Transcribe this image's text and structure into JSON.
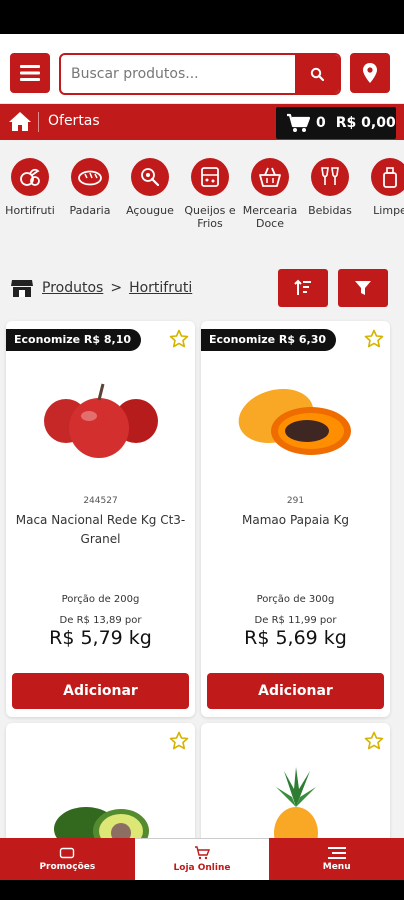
{
  "colors": {
    "primary": "#c01a1a",
    "dark": "#111111"
  },
  "search": {
    "placeholder": "Buscar produtos..."
  },
  "nav": {
    "section": "Ofertas"
  },
  "cart": {
    "count": "0",
    "total": "R$ 0,00"
  },
  "categories": [
    {
      "label": "Hortifruti",
      "icon": "vegetables-icon"
    },
    {
      "label": "Padaria",
      "icon": "bread-icon"
    },
    {
      "label": "Açougue",
      "icon": "meat-icon"
    },
    {
      "label": "Queijos e Frios",
      "icon": "cheese-icon"
    },
    {
      "label": "Mercearia Doce",
      "icon": "basket-icon"
    },
    {
      "label": "Bebidas",
      "icon": "wine-glasses-icon"
    },
    {
      "label": "Limpe",
      "icon": "cleaning-icon"
    }
  ],
  "breadcrumb": {
    "root": "Produtos",
    "sep": ">",
    "current": "Hortifruti"
  },
  "products": [
    {
      "badge": "Economize R$ 8,10",
      "code": "244527",
      "name": "Maca Nacional Rede Kg Ct3-Granel",
      "portion": "Porção de 200g",
      "old_price": "De R$ 13,89 por",
      "price": "R$ 5,79 kg",
      "button": "Adicionar",
      "image": "red-apples"
    },
    {
      "badge": "Economize R$ 6,30",
      "code": "291",
      "name": "Mamao Papaia Kg",
      "portion": "Porção de 300g",
      "old_price": "De R$ 11,99 por",
      "price": "R$ 5,69 kg",
      "button": "Adicionar",
      "image": "papaya"
    },
    {
      "image": "avocado"
    },
    {
      "image": "pineapple"
    }
  ],
  "bottom_nav": {
    "promo": "Promoções",
    "store": "Loja Online",
    "menu": "Menu"
  }
}
